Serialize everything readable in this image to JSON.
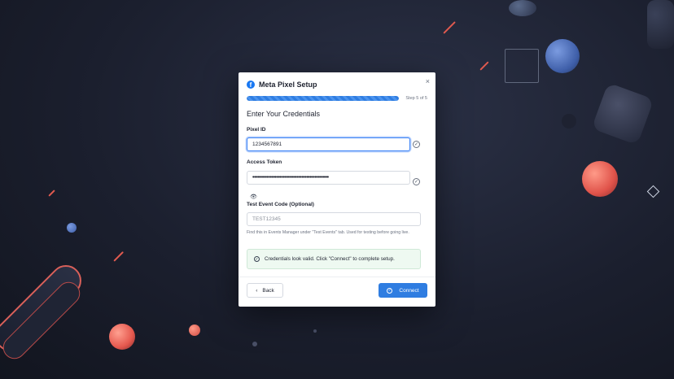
{
  "modal": {
    "title": "Meta Pixel Setup",
    "close_icon": "×",
    "brand_icon": "facebook-icon",
    "progress": {
      "fraction": 1.0,
      "label": "Step 5 of 5"
    },
    "heading": "Enter Your Credentials",
    "pixel_id": {
      "label": "Pixel ID",
      "value": "1234567891",
      "status_icon": "check-circle-icon"
    },
    "access_token": {
      "label": "Access Token",
      "value": "••••••••••••••••••••••••••••••••••••••••••••••••",
      "status_icon": "check-circle-icon",
      "toggle_icon": "eye-icon"
    },
    "test_event": {
      "label": "Test Event Code (Optional)",
      "placeholder": "TEST12345",
      "hint": "Find this in Events Manager under \"Test Events\" tab. Used for testing before going live."
    },
    "alert": {
      "text": "Credentials look valid. Click \"Connect\" to complete setup.",
      "icon": "check-circle-icon"
    },
    "back_button": {
      "label": "Back",
      "icon": "‹"
    },
    "connect_button": {
      "label": "Connect",
      "icon": "check-circle-icon"
    }
  },
  "colors": {
    "accent": "#2f7de1",
    "success_bg": "#eef9f1",
    "brand": "#1877f2"
  }
}
